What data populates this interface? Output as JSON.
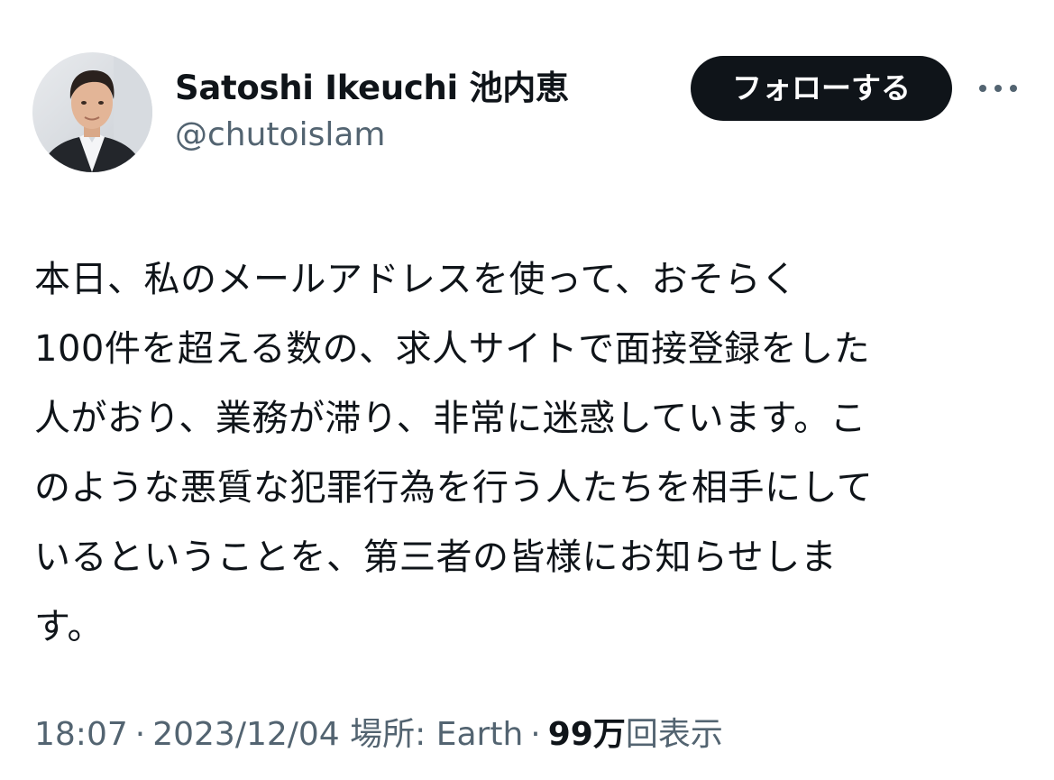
{
  "author": {
    "display_name": "Satoshi Ikeuchi 池内恵",
    "handle": "@chutoislam"
  },
  "follow_button": {
    "label": "フォローする"
  },
  "more_icon": "more-horizontal-icon",
  "tweet": {
    "lines": [
      "本日、私のメールアドレスを使って、おそらく",
      "100件を超える数の、求人サイトで面接登録をした",
      "人がおり、業務が滞り、非常に迷惑しています。こ",
      "のような悪質な犯罪行為を行う人たちを相手にして",
      "いるということを、第三者の皆様にお知らせしま",
      "す。"
    ]
  },
  "meta": {
    "time": "18:07",
    "separator": "·",
    "date": "2023/12/04",
    "location": "場所: Earth",
    "views_count": "99万",
    "views_label": "回表示"
  },
  "colors": {
    "text_primary": "#0f1419",
    "text_secondary": "#536471",
    "follow_bg": "#0f1419",
    "follow_text": "#ffffff"
  }
}
